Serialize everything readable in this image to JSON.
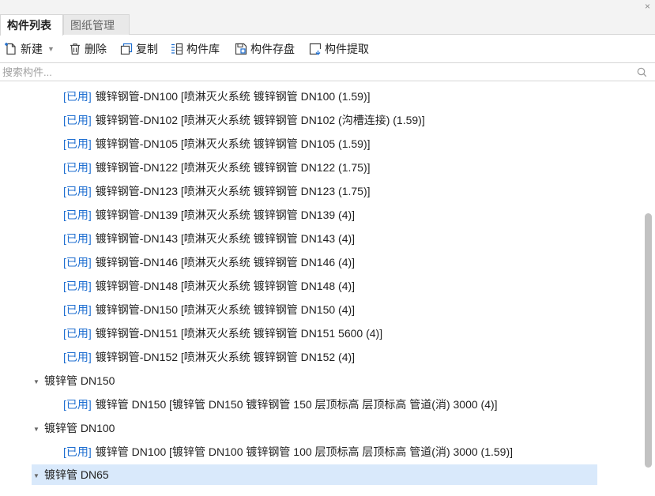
{
  "window": {
    "close_glyph": "×"
  },
  "tabs": [
    {
      "label": "构件列表",
      "active": true
    },
    {
      "label": "图纸管理",
      "active": false
    }
  ],
  "toolbar": {
    "new_label": "新建",
    "delete_label": "删除",
    "copy_label": "复制",
    "library_label": "构件库",
    "save_label": "构件存盘",
    "extract_label": "构件提取"
  },
  "search": {
    "placeholder": "搜索构件..."
  },
  "colors": {
    "status_blue": "#1f6fd1",
    "selected_bg": "#d9e9fb"
  },
  "tree": {
    "rows": [
      {
        "type": "leaf",
        "status": "[已用]",
        "text": "镀锌钢管-DN100 [喷淋灭火系统 镀锌钢管 DN100 (1.59)]"
      },
      {
        "type": "leaf",
        "status": "[已用]",
        "text": "镀锌钢管-DN102 [喷淋灭火系统 镀锌钢管 DN102 (沟槽连接) (1.59)]"
      },
      {
        "type": "leaf",
        "status": "[已用]",
        "text": "镀锌钢管-DN105 [喷淋灭火系统 镀锌钢管 DN105 (1.59)]"
      },
      {
        "type": "leaf",
        "status": "[已用]",
        "text": "镀锌钢管-DN122 [喷淋灭火系统 镀锌钢管 DN122 (1.75)]"
      },
      {
        "type": "leaf",
        "status": "[已用]",
        "text": "镀锌钢管-DN123 [喷淋灭火系统 镀锌钢管 DN123 (1.75)]"
      },
      {
        "type": "leaf",
        "status": "[已用]",
        "text": "镀锌钢管-DN139 [喷淋灭火系统 镀锌钢管 DN139 (4)]"
      },
      {
        "type": "leaf",
        "status": "[已用]",
        "text": "镀锌钢管-DN143 [喷淋灭火系统 镀锌钢管 DN143 (4)]"
      },
      {
        "type": "leaf",
        "status": "[已用]",
        "text": "镀锌钢管-DN146 [喷淋灭火系统 镀锌钢管 DN146 (4)]"
      },
      {
        "type": "leaf",
        "status": "[已用]",
        "text": "镀锌钢管-DN148 [喷淋灭火系统 镀锌钢管 DN148 (4)]"
      },
      {
        "type": "leaf",
        "status": "[已用]",
        "text": "镀锌钢管-DN150 [喷淋灭火系统 镀锌钢管 DN150 (4)]"
      },
      {
        "type": "leaf",
        "status": "[已用]",
        "text": "镀锌钢管-DN151 [喷淋灭火系统 镀锌钢管 DN151 5600 (4)]"
      },
      {
        "type": "leaf",
        "status": "[已用]",
        "text": "镀锌钢管-DN152 [喷淋灭火系统 镀锌钢管 DN152 (4)]"
      },
      {
        "type": "group",
        "text": "镀锌管 DN150"
      },
      {
        "type": "leaf",
        "status": "[已用]",
        "text": "镀锌管 DN150 [镀锌管 DN150 镀锌钢管 150 层顶标高 层顶标高 管道(消) 3000 (4)]"
      },
      {
        "type": "group",
        "text": "镀锌管 DN100"
      },
      {
        "type": "leaf",
        "status": "[已用]",
        "text": "镀锌管 DN100 [镀锌管 DN100 镀锌钢管 100 层顶标高 层顶标高 管道(消) 3000 (1.59)]"
      },
      {
        "type": "group",
        "text": "镀锌管 DN65",
        "selected": true
      }
    ]
  }
}
